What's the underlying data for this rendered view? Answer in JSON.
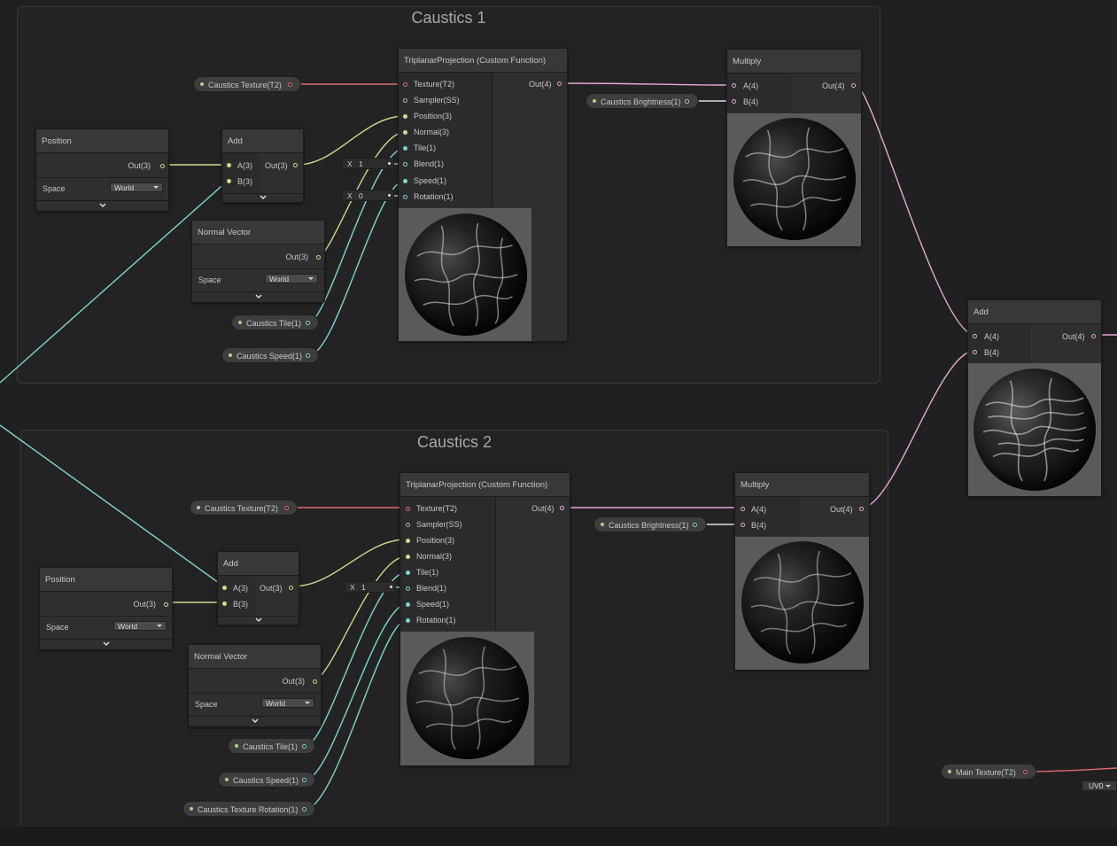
{
  "groups": {
    "caustics1": {
      "title": "Caustics 1"
    },
    "caustics2": {
      "title": "Caustics 2"
    }
  },
  "nodes": {
    "triplanar": {
      "title": "TriplanarProjection (Custom Function)",
      "inputs": [
        "Texture(T2)",
        "Sampler(SS)",
        "Position(3)",
        "Normal(3)",
        "Tile(1)",
        "Blend(1)",
        "Speed(1)",
        "Rotation(1)"
      ],
      "output": "Out(4)"
    },
    "multiply": {
      "title": "Multiply",
      "inputs": [
        "A(4)",
        "B(4)"
      ],
      "output": "Out(4)"
    },
    "add": {
      "title": "Add",
      "inputs_vec3": [
        "A(3)",
        "B(3)"
      ],
      "output_vec3": "Out(3)",
      "inputs_vec4": [
        "A(4)",
        "B(4)"
      ],
      "output_vec4": "Out(4)"
    },
    "position": {
      "title": "Position",
      "output": "Out(3)",
      "space_label": "Space",
      "space_value": "World"
    },
    "normal_vector": {
      "title": "Normal Vector",
      "output": "Out(3)",
      "space_label": "Space",
      "space_value": "World"
    }
  },
  "properties": {
    "caustics_texture": "Caustics Texture(T2)",
    "caustics_brightness": "Caustics Brightness(1)",
    "caustics_tile": "Caustics Tile(1)",
    "caustics_speed": "Caustics Speed(1)",
    "caustics_texture_rotation": "Caustics Texture Rotation(1)",
    "main_texture": "Main Texture(T2)"
  },
  "fields": {
    "x_label": "X",
    "blend_value_1": "1",
    "rotation_value_1": "0",
    "blend_value_2": "1"
  },
  "uv_dropdown": "UV0",
  "colors": {
    "background": "#202020",
    "node": "#2f2f2f",
    "wire_yellow": "#d2d68e",
    "wire_cyan": "#7fd4d4",
    "wire_red": "#e06c6c",
    "wire_pink": "#e6a8d8"
  }
}
